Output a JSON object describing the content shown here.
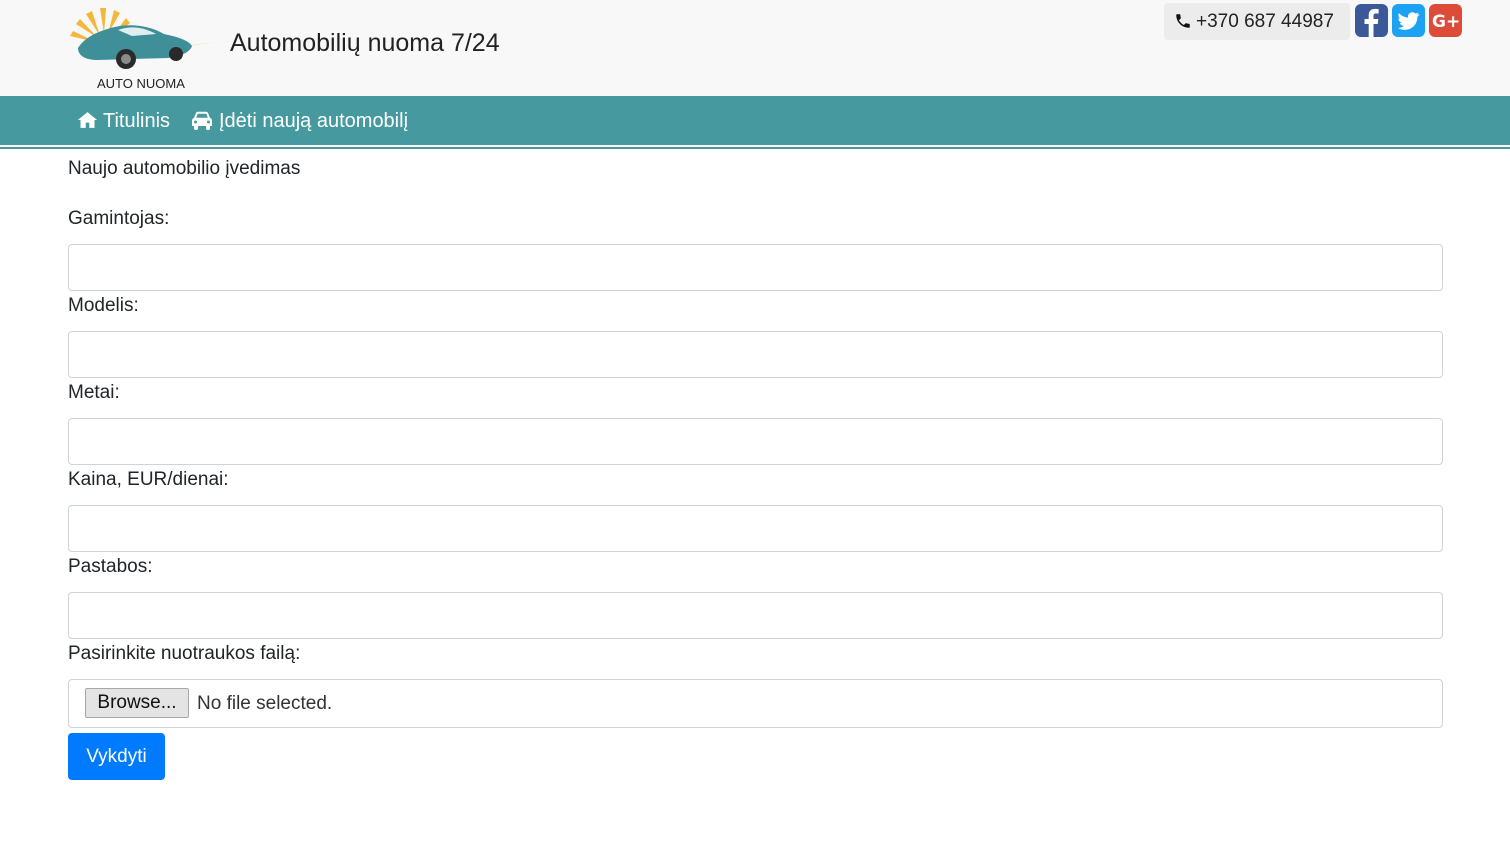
{
  "header": {
    "logo_text": "AUTO NUOMA",
    "title": "Automobilių nuoma 7/24",
    "phone": "+370 687 44987",
    "social": [
      {
        "name": "facebook-icon",
        "color": "#3b5998"
      },
      {
        "name": "twitter-icon",
        "color": "#1da1f2"
      },
      {
        "name": "google-plus-icon",
        "color": "#dd4b39"
      }
    ]
  },
  "nav": {
    "home_label": "Titulinis",
    "add_car_label": "Įdėti naują automobilį",
    "background": "#4799a0"
  },
  "form": {
    "heading": "Naujo automobilio įvedimas",
    "fields": [
      {
        "label": "Gamintojas:",
        "value": ""
      },
      {
        "label": "Modelis:",
        "value": ""
      },
      {
        "label": "Metai:",
        "value": ""
      },
      {
        "label": "Kaina, EUR/dienai:",
        "value": ""
      },
      {
        "label": "Pastabos:",
        "value": ""
      }
    ],
    "file_label": "Pasirinkite nuotraukos failą:",
    "browse_label": "Browse...",
    "file_status": "No file selected.",
    "submit_label": "Vykdyti",
    "submit_color": "#007bff"
  }
}
